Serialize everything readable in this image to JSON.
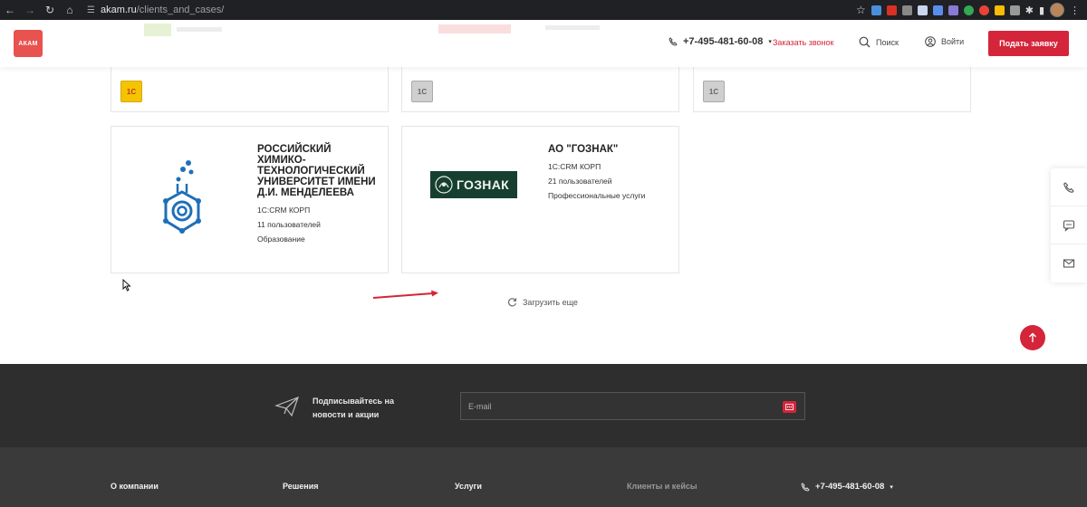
{
  "browser": {
    "url_host": "akam.ru",
    "url_path": "/clients_and_cases/"
  },
  "header": {
    "logo_text": "АКАМ",
    "phone": "+7-495-481-60-08",
    "phone_caret": "▾",
    "callback_label": "Заказать звонок",
    "search_label": "Поиск",
    "login_label": "Войти",
    "submit_label": "Подать заявку"
  },
  "top_cards": [
    {
      "badge": "1С",
      "badge_color": "#f5c400"
    },
    {
      "badge": "1С",
      "badge_color": "#bdbdbd"
    },
    {
      "badge": "1С",
      "badge_color": "#bdbdbd"
    }
  ],
  "clients": [
    {
      "title": "РОССИЙСКИЙ ХИМИКО-ТЕХНОЛОГИЧЕСКИЙ УНИВЕРСИТЕТ ИМЕНИ Д.И. МЕНДЕЛЕЕВА",
      "product": "1С:CRM КОРП",
      "users": "11 пользователей",
      "industry": "Образование"
    },
    {
      "title": "АО \"ГОЗНАК\"",
      "logo_text": "ГОЗНАК",
      "product": "1С:CRM КОРП",
      "users": "21 пользователей",
      "industry": "Профессиональные услуги"
    }
  ],
  "load_more_label": "Загрузить еще",
  "subscribe": {
    "text": "Подписывайтесь на новости и акции",
    "email_placeholder": "E-mail"
  },
  "footer": {
    "columns": [
      "О компании",
      "Решения",
      "Услуги",
      "Клиенты и кейсы"
    ],
    "phone": "+7-495-481-60-08",
    "phone_caret": "▾"
  },
  "colors": {
    "accent": "#d4253a",
    "logo": "#e8524f",
    "footer_dark": "#2e2e2e"
  }
}
